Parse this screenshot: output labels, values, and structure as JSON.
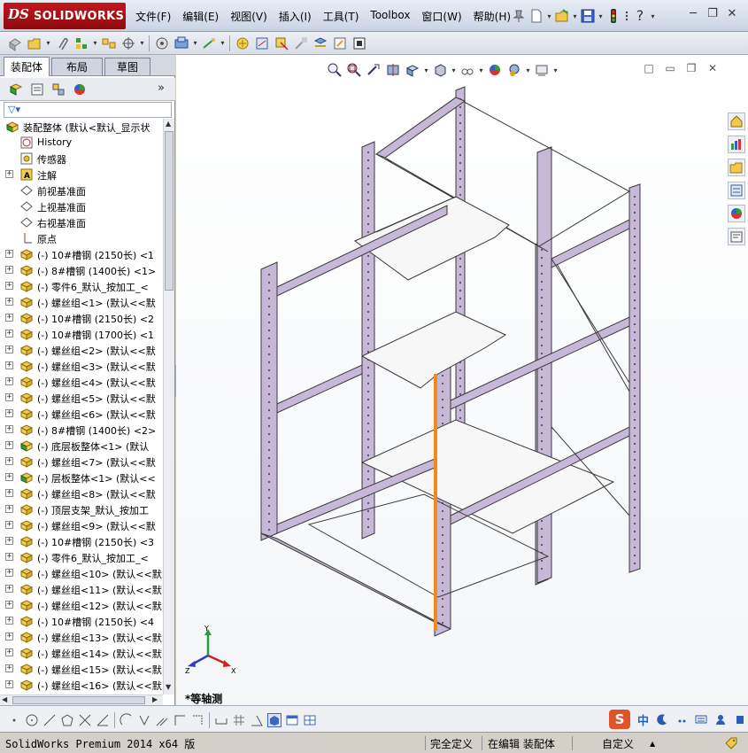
{
  "titlebar": {
    "logo_ds": "DS",
    "logo_text": "SOLIDWORKS",
    "menu": [
      "文件(F)",
      "编辑(E)",
      "视图(V)",
      "插入(I)",
      "工具(T)",
      "Toolbox",
      "窗口(W)",
      "帮助(H)"
    ],
    "help_label": "?"
  },
  "feature_manager": {
    "tabs": [
      "装配体",
      "布局",
      "草图"
    ],
    "more": "»",
    "tree": [
      {
        "label": "装配整体  (默认<默认_显示状",
        "icon": "assembly-icon",
        "level": 0,
        "expander": ""
      },
      {
        "label": "History",
        "icon": "history-icon",
        "level": 1,
        "expander": ""
      },
      {
        "label": "传感器",
        "icon": "sensor-icon",
        "level": 1,
        "expander": ""
      },
      {
        "label": "注解",
        "icon": "annotation-icon",
        "level": 1,
        "expander": "+"
      },
      {
        "label": "前视基准面",
        "icon": "plane-icon",
        "level": 1,
        "expander": ""
      },
      {
        "label": "上视基准面",
        "icon": "plane-icon",
        "level": 1,
        "expander": ""
      },
      {
        "label": "右视基准面",
        "icon": "plane-icon",
        "level": 1,
        "expander": ""
      },
      {
        "label": "原点",
        "icon": "origin-icon",
        "level": 1,
        "expander": ""
      },
      {
        "label": "(-) 10#槽钢 (2150长) <1",
        "icon": "part-icon",
        "level": 1,
        "expander": "+"
      },
      {
        "label": "(-) 8#槽钢 (1400长) <1>",
        "icon": "part-icon",
        "level": 1,
        "expander": "+"
      },
      {
        "label": "(-) 零件6_默认_按加工_<",
        "icon": "part-icon",
        "level": 1,
        "expander": "+"
      },
      {
        "label": "(-) 螺丝组<1> (默认<<默",
        "icon": "part-icon",
        "level": 1,
        "expander": "+"
      },
      {
        "label": "(-) 10#槽钢 (2150长) <2",
        "icon": "part-icon",
        "level": 1,
        "expander": "+"
      },
      {
        "label": "(-) 10#槽钢 (1700长) <1",
        "icon": "part-icon",
        "level": 1,
        "expander": "+"
      },
      {
        "label": "(-) 螺丝组<2> (默认<<默",
        "icon": "part-icon",
        "level": 1,
        "expander": "+"
      },
      {
        "label": "(-) 螺丝组<3> (默认<<默",
        "icon": "part-icon",
        "level": 1,
        "expander": "+"
      },
      {
        "label": "(-) 螺丝组<4> (默认<<默",
        "icon": "part-icon",
        "level": 1,
        "expander": "+"
      },
      {
        "label": "(-) 螺丝组<5> (默认<<默",
        "icon": "part-icon",
        "level": 1,
        "expander": "+"
      },
      {
        "label": "(-) 螺丝组<6> (默认<<默",
        "icon": "part-icon",
        "level": 1,
        "expander": "+"
      },
      {
        "label": "(-) 8#槽钢 (1400长) <2>",
        "icon": "part-icon",
        "level": 1,
        "expander": "+"
      },
      {
        "label": "(-) 底层板整体<1> (默认",
        "icon": "subassembly-icon",
        "level": 1,
        "expander": "+"
      },
      {
        "label": "(-) 螺丝组<7> (默认<<默",
        "icon": "part-icon",
        "level": 1,
        "expander": "+"
      },
      {
        "label": "(-) 层板整体<1> (默认<<",
        "icon": "subassembly-icon",
        "level": 1,
        "expander": "+"
      },
      {
        "label": "(-) 螺丝组<8> (默认<<默",
        "icon": "part-icon",
        "level": 1,
        "expander": "+"
      },
      {
        "label": "(-) 顶层支架_默认_按加工",
        "icon": "part-icon",
        "level": 1,
        "expander": "+"
      },
      {
        "label": "(-) 螺丝组<9> (默认<<默",
        "icon": "part-icon",
        "level": 1,
        "expander": "+"
      },
      {
        "label": "(-) 10#槽钢 (2150长) <3",
        "icon": "part-icon",
        "level": 1,
        "expander": "+"
      },
      {
        "label": "(-) 零件6_默认_按加工_<",
        "icon": "part-icon",
        "level": 1,
        "expander": "+"
      },
      {
        "label": "(-) 螺丝组<10> (默认<<默",
        "icon": "part-icon",
        "level": 1,
        "expander": "+"
      },
      {
        "label": "(-) 螺丝组<11> (默认<<默",
        "icon": "part-icon",
        "level": 1,
        "expander": "+"
      },
      {
        "label": "(-) 螺丝组<12> (默认<<默",
        "icon": "part-icon",
        "level": 1,
        "expander": "+"
      },
      {
        "label": "(-) 10#槽钢 (2150长) <4",
        "icon": "part-icon",
        "level": 1,
        "expander": "+"
      },
      {
        "label": "(-) 螺丝组<13> (默认<<默",
        "icon": "part-icon",
        "level": 1,
        "expander": "+"
      },
      {
        "label": "(-) 螺丝组<14> (默认<<默",
        "icon": "part-icon",
        "level": 1,
        "expander": "+"
      },
      {
        "label": "(-) 螺丝组<15> (默认<<默",
        "icon": "part-icon",
        "level": 1,
        "expander": "+"
      },
      {
        "label": "(-) 螺丝组<16> (默认<<默",
        "icon": "part-icon",
        "level": 1,
        "expander": "+"
      }
    ]
  },
  "viewport": {
    "view_label": "*等轴测",
    "triad": {
      "x": "X",
      "y": "Y",
      "z": "Z"
    },
    "colors": {
      "rack_frame": "#c8b8d8",
      "rack_stroke": "#3a3a3a",
      "shelf": "#f7f7f7",
      "highlight": "#f08a1c"
    }
  },
  "ime": {
    "logo": "S",
    "lang": "中"
  },
  "statusbar": {
    "product": "SolidWorks Premium 2014 x64 版",
    "constraint": "完全定义",
    "mode": "在编辑 装配体",
    "units": "自定义",
    "units_arrow": "▲"
  }
}
